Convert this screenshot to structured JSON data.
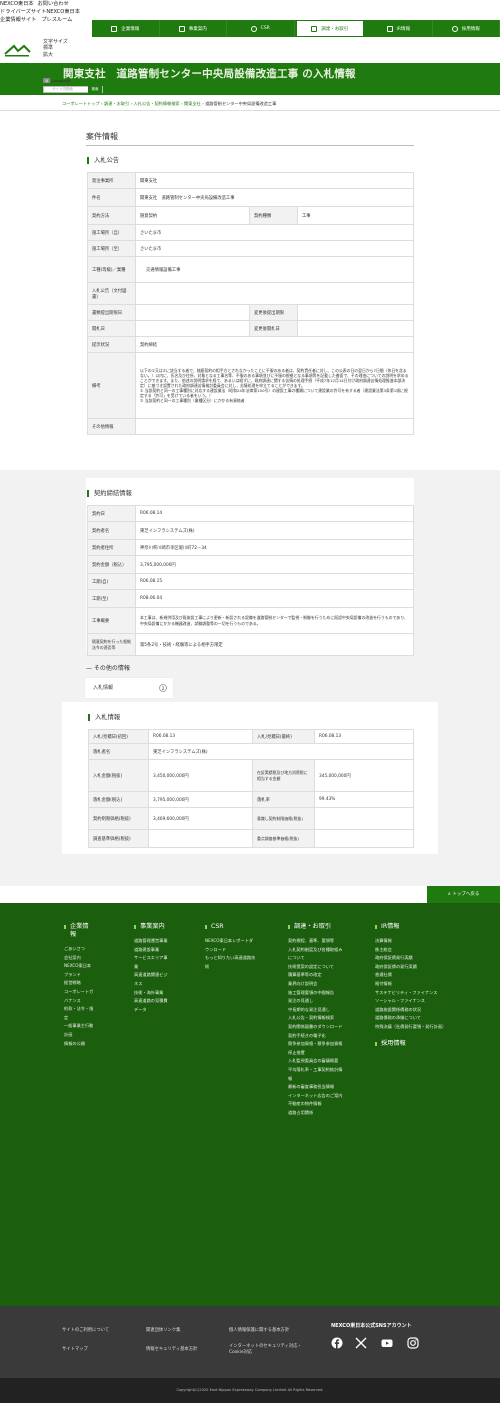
{
  "util": {
    "l1a": "NEXCO東日本",
    "l1b": "お問い合わせ",
    "l2a": "ドライバーズサイト",
    "l2b": "NEXCO東日本",
    "l3a": "企業情報サイト",
    "l3b": "プレスルーム"
  },
  "nav": [
    {
      "label": "企業情報",
      "active": false
    },
    {
      "label": "事業案内",
      "active": false
    },
    {
      "label": "CSR",
      "active": false
    },
    {
      "label": "調達・お取引",
      "active": true
    },
    {
      "label": "IR情報",
      "active": false
    },
    {
      "label": "採用情報",
      "active": false
    }
  ],
  "font_size": {
    "label": "文字サイズ",
    "std": "標準",
    "large": "拡大"
  },
  "language": {
    "label": "Language"
  },
  "search": {
    "placeholder": "サイト内検索",
    "button": "検索"
  },
  "hero": {
    "title": "関東支社　道路管制センター中央局設備改造工事 の入札情報"
  },
  "breadcrumb": {
    "items": [
      "コーポレートトップ",
      "調達・お取引",
      "入札公告・契約情報検索",
      "関東支社"
    ],
    "current": "道路管制センター中央局設備改造工事"
  },
  "case": {
    "title": "案件情報",
    "notice_title": "入札公告",
    "rows": [
      {
        "label": "発注事業所",
        "value": "関東支社"
      },
      {
        "label": "件名",
        "value": "関東支社　道路管制センター中央局設備改造工事"
      },
      {
        "label": "契約方法",
        "value": "随意契約",
        "label2": "契約種類",
        "value2": "工事"
      },
      {
        "label": "施工場所（自）",
        "value": "さいたま市"
      },
      {
        "label": "施工場所（至）",
        "value": "さいたま市"
      },
      {
        "label": "工種(等級)／業種",
        "value": "交通情報設備工事"
      },
      {
        "label": "入札公告（文付図書）",
        "value": ""
      },
      {
        "label": "書類提出期限日",
        "value": "",
        "label2": "変更後提出期限",
        "value2": ""
      },
      {
        "label": "開札日",
        "value": "",
        "label2": "変更後開札日",
        "value2": ""
      },
      {
        "label": "提示状況",
        "value": "契約締結"
      },
      {
        "label": "備考",
        "value": "以下の①又は②に該当する者で、随意契約の相手方とされなかったことに不服のある者は、契約責任者に対し、この公表の日の翌日から7日間（休日を含まない。）以内に、氏名及び住所、対象となる工事名等、不服のある事項並びに不服の根拠となる事項等を記載した書面で、その理由についての説明を求めることができます。また、前述の説明請求を経て、あるいは経ずに、政府調達に関する苦情の処理手続（平成7年12月14日付け政府調達苦情処理推進本部決定）に基づき設置された政府調達苦情検討委員会に対し、苦情処理を申立てることができます。\n① 当該契約と同一の工事種別に対応する建設業法（昭和24年法律第100号）の建設工事の種類について建設業の許可を有する者（建設業法第3条第1項に規定する「許可」を受けている者をいう。）\n② 当該契約と同一の工事種別（業種区分）にかかる有資格者"
      },
      {
        "label": "その他情報",
        "value": ""
      }
    ]
  },
  "contract": {
    "title": "契約締結情報",
    "rows": [
      {
        "label": "契約日",
        "value": "R06.08.14"
      },
      {
        "label": "契約者名",
        "value": "東芝インフラシステムズ(株)"
      },
      {
        "label": "契約者住所",
        "value": "神奈川県川崎市幸区堀川町72－34"
      },
      {
        "label": "契約金額（税込）",
        "value": "3,795,000,000円"
      },
      {
        "label": "工期(自)",
        "value": "R06.08.15"
      },
      {
        "label": "工期(至)",
        "value": "R08.06.04"
      },
      {
        "label": "工事概要",
        "value": "本工事は、新規供用及び既施設工事により更新・新設される設備を道路管制センターで監視・制御を行うために既設中央局設備の改造を行うものであり、中央局設備にかかる機器改造、試験調整等の一切を行うものである。"
      },
      {
        "label": "随意契約を行った根拠法令の適否等",
        "value": "第5条2号・技術・経験等による相手方限定"
      }
    ]
  },
  "other": {
    "title": "その他の情報",
    "tab": "入札情報",
    "tab_num": "2"
  },
  "bid": {
    "title": "入札情報",
    "rows": [
      {
        "label": "入札/見積日(初回)",
        "value": "R06.08.13",
        "label2": "入札/見積日(最終)",
        "value2": "R06.08.13"
      },
      {
        "label": "落札者名",
        "value": "東芝インフラシステムズ(株)"
      },
      {
        "label": "入札金額(税抜)",
        "value": "3,450,000,000円",
        "label2": "在証実績税及び地方消費税に相当する金額",
        "value2": "345,000,000円"
      },
      {
        "label": "落札金額(税込)",
        "value": "3,795,000,000円",
        "label2": "落札率",
        "value2": "99.43%"
      },
      {
        "label": "契約制限価格(税抜)",
        "value": "3,469,600,000円",
        "label2": "意識し契約制限価格(税抜)",
        "value2": ""
      },
      {
        "label": "調査基準価格(税抜)",
        "value": "",
        "label2": "重点調査基準価格(税抜)",
        "value2": ""
      }
    ]
  },
  "pagetop": "トップへ戻る",
  "footer": {
    "cols": [
      {
        "head": "企業情報",
        "links": [
          "ごあいさつ",
          "会社案内",
          "NEXCO東日本ブランド",
          "経営戦略",
          "コーポレートガバナンス",
          "約款・法令・指定",
          "一般事業主行動計画",
          "情報の公開"
        ]
      },
      {
        "head": "事業案内",
        "links": [
          "道路管理運営事業",
          "道路建設事業",
          "サービスエリア事業",
          "高速道路関連ビジネス",
          "技術・海外事業",
          "高速道路の見積費データ"
        ]
      },
      {
        "head": "CSR",
        "links": [
          "NEXCO東日本レポートダウンロード",
          "もっと知りたい高速道路技術"
        ]
      },
      {
        "head": "調達・お取引",
        "links": [
          "契約規程、基準、要領等",
          "入札契約制度及び各種取組みについて",
          "技術提案の設定について",
          "積算基準等の改定",
          "業界向け説明会",
          "施工管理要領の中間報告",
          "発注の見通し",
          "中長期的な発注見通し",
          "入札公告・契約情報検索",
          "契約関係図書のダウンロード",
          "契約手続きの電子化",
          "競争参加資格・競争参加資格停止措置",
          "入札監視委員会の審議概要",
          "平均落札率・工事契約統計情報",
          "最新の審査事務担当情報",
          "インターネット広告のご案内",
          "不動産の物件情報",
          "道路占用関係"
        ]
      },
      {
        "head": "IR情報",
        "links": [
          "決算情報",
          "株主総会",
          "政府保証債発行実績",
          "政府保証債の発行実績",
          "普通社債",
          "格付情報",
          "サステナビリティ・ファイナンス",
          "ソーシャル・ファイナンス",
          "道路施設関係債務の状況",
          "道路債務の承継について",
          "特殊決議（社債発行要領・発行計画）"
        ]
      },
      {
        "head": "採用情報",
        "links": []
      }
    ]
  },
  "bottom": {
    "links": [
      "サイトのご利用について",
      "サイトマップ",
      "関連団体リンク集",
      "情報セキュリティ基本方針",
      "個人情報保護に関する基本方針",
      "インターネットのセキュリティ対応・Cookie対応"
    ],
    "sns_title": "NEXCO東日本公式SNSアカウント",
    "sns": [
      "facebook-icon",
      "x-icon",
      "youtube-icon",
      "instagram-icon"
    ]
  },
  "copyright": "Copyright(C)2020 East Nippon Expressway Company Limited All Rights Reserved.",
  "colors": {
    "brand": "#1f7a0f",
    "footer": "#1b5e0d"
  }
}
